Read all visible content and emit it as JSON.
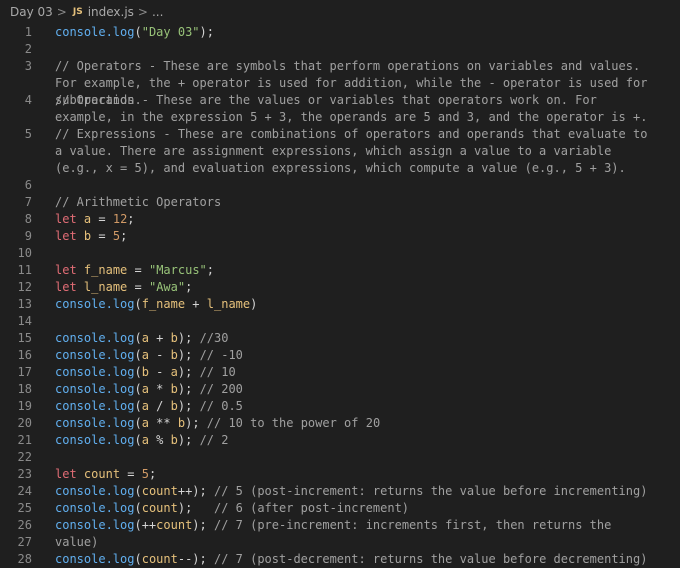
{
  "breadcrumb": {
    "folder": "Day 03",
    "sep": ">",
    "js_badge": "JS",
    "file": "index.js",
    "more": "..."
  },
  "lines": [
    {
      "n": "1",
      "segs": [
        [
          "fn",
          "console.log"
        ],
        [
          "p",
          "("
        ],
        [
          "str",
          "\"Day 03\""
        ],
        [
          "p",
          ");"
        ]
      ]
    },
    {
      "n": "2",
      "segs": []
    },
    {
      "n": "3",
      "wrap": 2,
      "segs": [
        [
          "cm",
          "// Operators - These are symbols that perform operations on variables and values. For example, the + operator is used for addition, while the - operator is used for subtraction."
        ]
      ]
    },
    {
      "n": "4",
      "wrap": 2,
      "segs": [
        [
          "cm",
          "// Operands - These are the values or variables that operators work on. For example, in the expression 5 + 3, the operands are 5 and 3, and the operator is +."
        ]
      ]
    },
    {
      "n": "5",
      "wrap": 3,
      "segs": [
        [
          "cm",
          "// Expressions - These are combinations of operators and operands that evaluate to a value. There are assignment expressions, which assign a value to a variable (e.g., x = 5), and evaluation expressions, which compute a value (e.g., 5 + 3)."
        ]
      ]
    },
    {
      "n": "6",
      "segs": []
    },
    {
      "n": "7",
      "segs": [
        [
          "cm",
          "// Arithmetic Operators"
        ]
      ]
    },
    {
      "n": "8",
      "segs": [
        [
          "kw",
          "let"
        ],
        [
          "p",
          " "
        ],
        [
          "var",
          "a"
        ],
        [
          "p",
          " = "
        ],
        [
          "num",
          "12"
        ],
        [
          "p",
          ";"
        ]
      ]
    },
    {
      "n": "9",
      "segs": [
        [
          "kw",
          "let"
        ],
        [
          "p",
          " "
        ],
        [
          "var",
          "b"
        ],
        [
          "p",
          " = "
        ],
        [
          "num",
          "5"
        ],
        [
          "p",
          ";"
        ]
      ]
    },
    {
      "n": "10",
      "segs": []
    },
    {
      "n": "11",
      "segs": [
        [
          "kw",
          "let"
        ],
        [
          "p",
          " "
        ],
        [
          "var",
          "f_name"
        ],
        [
          "p",
          " = "
        ],
        [
          "str",
          "\"Marcus\""
        ],
        [
          "p",
          ";"
        ]
      ]
    },
    {
      "n": "12",
      "segs": [
        [
          "kw",
          "let"
        ],
        [
          "p",
          " "
        ],
        [
          "var",
          "l_name"
        ],
        [
          "p",
          " = "
        ],
        [
          "str",
          "\"Awa\""
        ],
        [
          "p",
          ";"
        ]
      ]
    },
    {
      "n": "13",
      "segs": [
        [
          "fn",
          "console.log"
        ],
        [
          "p",
          "("
        ],
        [
          "var",
          "f_name"
        ],
        [
          "p",
          " + "
        ],
        [
          "var",
          "l_name"
        ],
        [
          "p",
          ")"
        ]
      ]
    },
    {
      "n": "14",
      "segs": []
    },
    {
      "n": "15",
      "segs": [
        [
          "fn",
          "console.log"
        ],
        [
          "p",
          "("
        ],
        [
          "var",
          "a"
        ],
        [
          "p",
          " + "
        ],
        [
          "var",
          "b"
        ],
        [
          "p",
          "); "
        ],
        [
          "cm",
          "//30"
        ]
      ]
    },
    {
      "n": "16",
      "segs": [
        [
          "fn",
          "console.log"
        ],
        [
          "p",
          "("
        ],
        [
          "var",
          "a"
        ],
        [
          "p",
          " - "
        ],
        [
          "var",
          "b"
        ],
        [
          "p",
          "); "
        ],
        [
          "cm",
          "// -10"
        ]
      ]
    },
    {
      "n": "17",
      "segs": [
        [
          "fn",
          "console.log"
        ],
        [
          "p",
          "("
        ],
        [
          "var",
          "b"
        ],
        [
          "p",
          " - "
        ],
        [
          "var",
          "a"
        ],
        [
          "p",
          "); "
        ],
        [
          "cm",
          "// 10"
        ]
      ]
    },
    {
      "n": "18",
      "segs": [
        [
          "fn",
          "console.log"
        ],
        [
          "p",
          "("
        ],
        [
          "var",
          "a"
        ],
        [
          "p",
          " * "
        ],
        [
          "var",
          "b"
        ],
        [
          "p",
          "); "
        ],
        [
          "cm",
          "// 200"
        ]
      ]
    },
    {
      "n": "19",
      "segs": [
        [
          "fn",
          "console.log"
        ],
        [
          "p",
          "("
        ],
        [
          "var",
          "a"
        ],
        [
          "p",
          " / "
        ],
        [
          "var",
          "b"
        ],
        [
          "p",
          "); "
        ],
        [
          "cm",
          "// 0.5"
        ]
      ]
    },
    {
      "n": "20",
      "segs": [
        [
          "fn",
          "console.log"
        ],
        [
          "p",
          "("
        ],
        [
          "var",
          "a"
        ],
        [
          "p",
          " ** "
        ],
        [
          "var",
          "b"
        ],
        [
          "p",
          "); "
        ],
        [
          "cm",
          "// 10 to the power of 20"
        ]
      ]
    },
    {
      "n": "21",
      "segs": [
        [
          "fn",
          "console.log"
        ],
        [
          "p",
          "("
        ],
        [
          "var",
          "a"
        ],
        [
          "p",
          " % "
        ],
        [
          "var",
          "b"
        ],
        [
          "p",
          "); "
        ],
        [
          "cm",
          "// 2"
        ]
      ]
    },
    {
      "n": "22",
      "segs": []
    },
    {
      "n": "23",
      "segs": [
        [
          "kw",
          "let"
        ],
        [
          "p",
          " "
        ],
        [
          "var",
          "count"
        ],
        [
          "p",
          " = "
        ],
        [
          "num",
          "5"
        ],
        [
          "p",
          ";"
        ]
      ]
    },
    {
      "n": "24",
      "segs": [
        [
          "fn",
          "console.log"
        ],
        [
          "p",
          "("
        ],
        [
          "var",
          "count"
        ],
        [
          "p",
          "++); "
        ],
        [
          "cm",
          "// 5 (post-increment: returns the value before incrementing)"
        ]
      ]
    },
    {
      "n": "25",
      "segs": [
        [
          "fn",
          "console.log"
        ],
        [
          "p",
          "("
        ],
        [
          "var",
          "count"
        ],
        [
          "p",
          ");   "
        ],
        [
          "cm",
          "// 6 (after post-increment)"
        ]
      ]
    },
    {
      "n": "26",
      "segs": [
        [
          "fn",
          "console.log"
        ],
        [
          "p",
          "(++"
        ],
        [
          "var",
          "count"
        ],
        [
          "p",
          "); "
        ],
        [
          "cm",
          "// 7 (pre-increment: increments first, then returns the value)"
        ]
      ]
    },
    {
      "n": "27",
      "segs": []
    },
    {
      "n": "28",
      "segs": [
        [
          "fn",
          "console.log"
        ],
        [
          "p",
          "("
        ],
        [
          "var",
          "count"
        ],
        [
          "p",
          "--); "
        ],
        [
          "cm",
          "// 7 (post-decrement: returns the value before decrementing)"
        ]
      ]
    }
  ]
}
